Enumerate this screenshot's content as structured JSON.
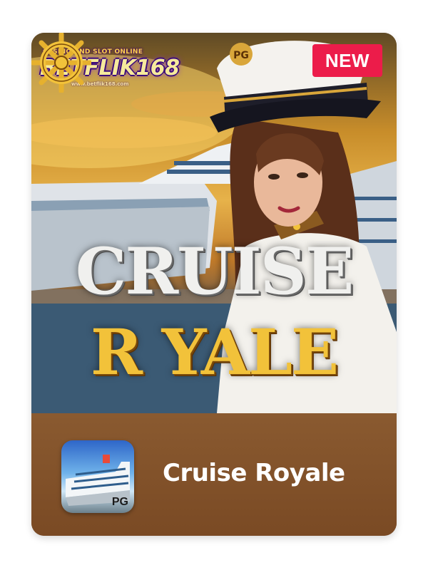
{
  "brand": {
    "tagline": "CASINO AND SLOT ONLINE",
    "name": "BETFLIK168",
    "url": "www.betflik168.com"
  },
  "badge": {
    "label": "NEW"
  },
  "hero": {
    "title_line1": "CRUISE",
    "title_line2": "R  YALE",
    "cap_badge": "PG"
  },
  "game": {
    "name": "Cruise Royale",
    "provider": "PG"
  },
  "colors": {
    "badge_bg": "#ec1c4a",
    "card_bottom": "#7a4a24",
    "title_gold": "#f2c23a"
  }
}
